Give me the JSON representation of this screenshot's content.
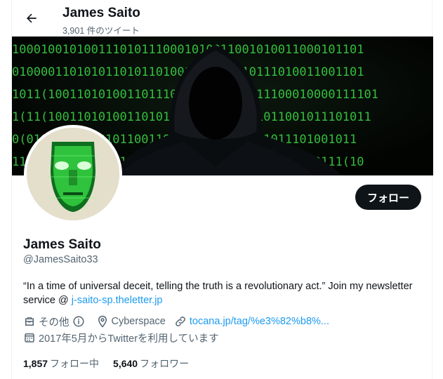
{
  "header": {
    "title": "James Saito",
    "tweet_count": "3,901 件のツイート"
  },
  "banner": {
    "digit_rows": [
      "1000100101001110101110001010011001010011000101101",
      "0100001101010110101101001011010010111010011001101",
      "1011(1001101010011011100010011010011100010000111101",
      "1(11(100110101001101011001101101011011001011101011",
      "0(0101011110010110011010110100101101011101001011",
      "1110100101001011010110010110011010110101110111(10"
    ]
  },
  "profile": {
    "name": "James Saito",
    "handle": "@JamesSaito33",
    "follow_label": "フォロー",
    "bio_text": "“In a time of universal deceit, telling the truth is a revolutionary act.” Join my newsletter service @ ",
    "bio_link": "j-saito-sp.theletter.jp",
    "category": "その他",
    "location": "Cyberspace",
    "website": "tocana.jp/tag/%e3%82%b8%...",
    "joined": "2017年5月からTwitterを利用しています",
    "following_count": "1,857",
    "following_label": "フォロー中",
    "followers_count": "5,640",
    "followers_label": "フォロワー"
  },
  "colors": {
    "accent": "#1d9bf0",
    "text": "#0f1419",
    "muted": "#536471",
    "banner_green": "#3ddc47"
  }
}
